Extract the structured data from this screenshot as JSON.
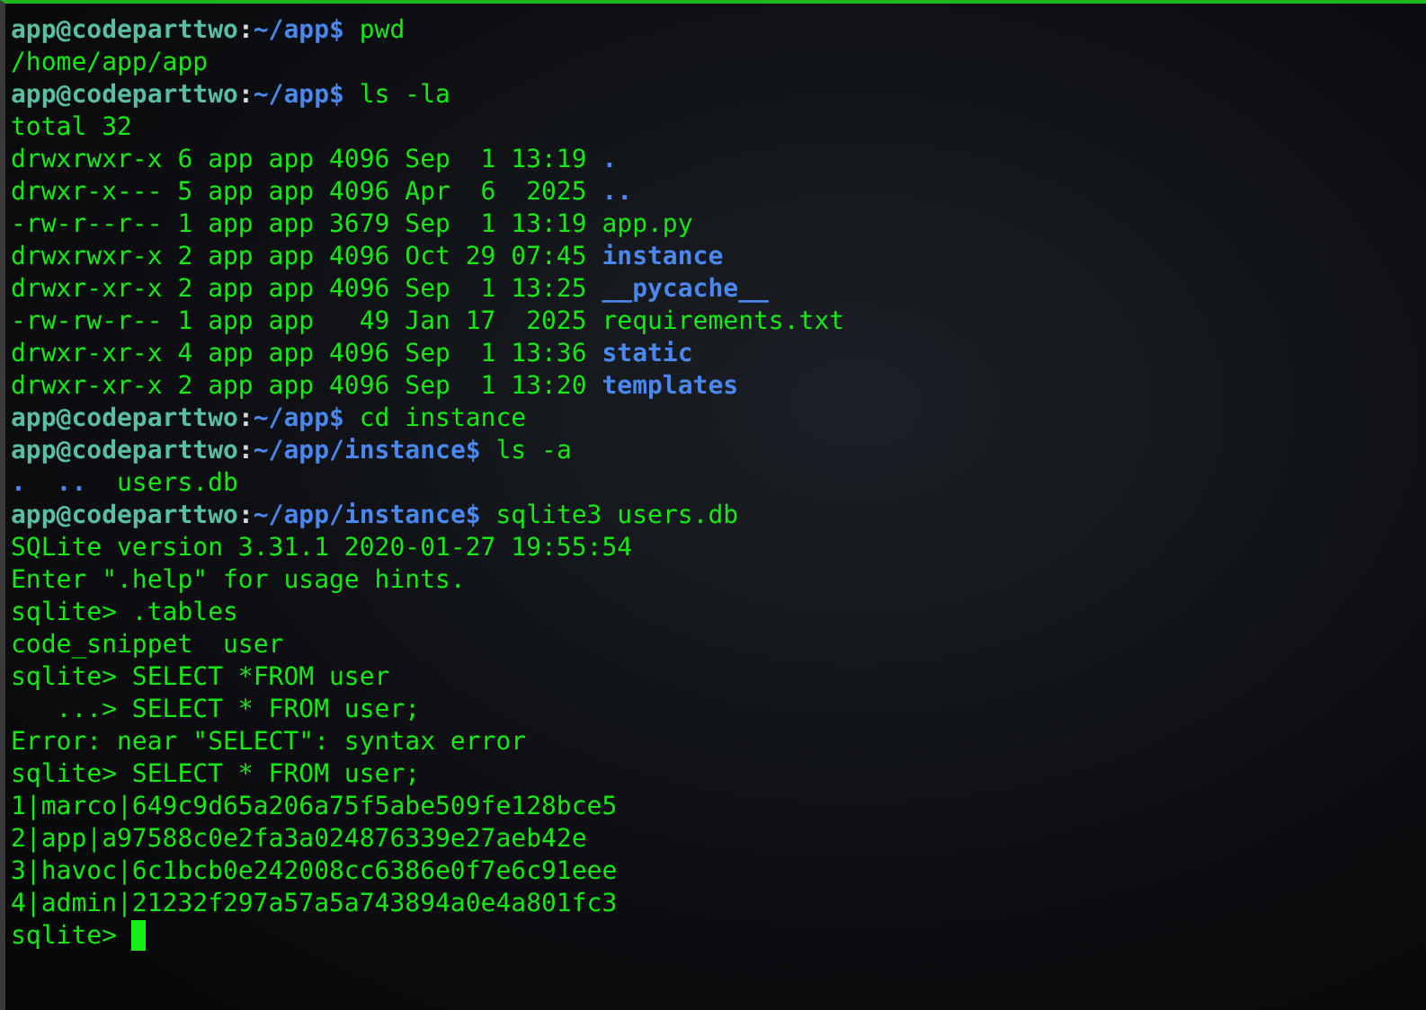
{
  "lines": [
    {
      "segments": [
        {
          "kind": "user",
          "text": "app@codeparttwo"
        },
        {
          "kind": "sep",
          "text": ":"
        },
        {
          "kind": "path",
          "text": "~/app$"
        },
        {
          "kind": "command",
          "text": "pwd"
        }
      ]
    },
    {
      "segments": [
        {
          "kind": "text",
          "text": "/home/app/app"
        }
      ]
    },
    {
      "segments": [
        {
          "kind": "user",
          "text": "app@codeparttwo"
        },
        {
          "kind": "sep",
          "text": ":"
        },
        {
          "kind": "path",
          "text": "~/app$"
        },
        {
          "kind": "command",
          "text": "ls -la"
        }
      ]
    },
    {
      "segments": [
        {
          "kind": "text",
          "text": "total 32"
        }
      ]
    },
    {
      "segments": [
        {
          "kind": "text",
          "text": "drwxrwxr-x 6 app app 4096 Sep  1 13:19"
        },
        {
          "kind": "dir",
          "text": "."
        }
      ]
    },
    {
      "segments": [
        {
          "kind": "text",
          "text": "drwxr-x--- 5 app app 4096 Apr  6  2025"
        },
        {
          "kind": "dir",
          "text": ".."
        }
      ]
    },
    {
      "segments": [
        {
          "kind": "text",
          "text": "-rw-r--r-- 1 app app 3679 Sep  1 13:19 app.py"
        }
      ]
    },
    {
      "segments": [
        {
          "kind": "text",
          "text": "drwxrwxr-x 2 app app 4096 Oct 29 07:45"
        },
        {
          "kind": "dir",
          "text": "instance"
        }
      ]
    },
    {
      "segments": [
        {
          "kind": "text",
          "text": "drwxr-xr-x 2 app app 4096 Sep  1 13:25"
        },
        {
          "kind": "dir",
          "text": "__pycache__"
        }
      ]
    },
    {
      "segments": [
        {
          "kind": "text",
          "text": "-rw-rw-r-- 1 app app   49 Jan 17  2025 requirements.txt"
        }
      ]
    },
    {
      "segments": [
        {
          "kind": "text",
          "text": "drwxr-xr-x 4 app app 4096 Sep  1 13:36"
        },
        {
          "kind": "dir",
          "text": "static"
        }
      ]
    },
    {
      "segments": [
        {
          "kind": "text",
          "text": "drwxr-xr-x 2 app app 4096 Sep  1 13:20"
        },
        {
          "kind": "dir",
          "text": "templates"
        }
      ]
    },
    {
      "segments": [
        {
          "kind": "user",
          "text": "app@codeparttwo"
        },
        {
          "kind": "sep",
          "text": ":"
        },
        {
          "kind": "path",
          "text": "~/app$"
        },
        {
          "kind": "command",
          "text": "cd instance"
        }
      ]
    },
    {
      "segments": [
        {
          "kind": "user",
          "text": "app@codeparttwo"
        },
        {
          "kind": "sep",
          "text": ":"
        },
        {
          "kind": "path",
          "text": "~/app/instance$"
        },
        {
          "kind": "command",
          "text": "ls -a"
        }
      ]
    },
    {
      "segments": [
        {
          "kind": "dir",
          "text": "."
        },
        {
          "kind": "dir",
          "text": ".."
        },
        {
          "kind": "file",
          "text": "users.db"
        }
      ]
    },
    {
      "segments": [
        {
          "kind": "user",
          "text": "app@codeparttwo"
        },
        {
          "kind": "sep",
          "text": ":"
        },
        {
          "kind": "path",
          "text": "~/app/instance$"
        },
        {
          "kind": "command",
          "text": "sqlite3 users.db"
        }
      ]
    },
    {
      "segments": [
        {
          "kind": "text",
          "text": "SQLite version 3.31.1 2020-01-27 19:55:54"
        }
      ]
    },
    {
      "segments": [
        {
          "kind": "text",
          "text": "Enter \".help\" for usage hints."
        }
      ]
    },
    {
      "segments": [
        {
          "kind": "text",
          "text": "sqlite> .tables"
        }
      ]
    },
    {
      "segments": [
        {
          "kind": "text",
          "text": "code_snippet  user"
        }
      ]
    },
    {
      "segments": [
        {
          "kind": "text",
          "text": "sqlite> SELECT *FROM user"
        }
      ]
    },
    {
      "segments": [
        {
          "kind": "text",
          "text": "   ...> SELECT * FROM user;"
        }
      ]
    },
    {
      "segments": [
        {
          "kind": "text",
          "text": "Error: near \"SELECT\": syntax error"
        }
      ]
    },
    {
      "segments": [
        {
          "kind": "text",
          "text": "sqlite> SELECT * FROM user;"
        }
      ]
    },
    {
      "segments": [
        {
          "kind": "text",
          "text": "1|marco|649c9d65a206a75f5abe509fe128bce5"
        }
      ]
    },
    {
      "segments": [
        {
          "kind": "text",
          "text": "2|app|a97588c0e2fa3a024876339e27aeb42e"
        }
      ]
    },
    {
      "segments": [
        {
          "kind": "text",
          "text": "3|havoc|6c1bcb0e242008cc6386e0f7e6c91eee"
        }
      ]
    },
    {
      "segments": [
        {
          "kind": "text",
          "text": "4|admin|21232f297a57a5a743894a0e4a801fc3"
        }
      ]
    },
    {
      "segments": [
        {
          "kind": "text",
          "text": "sqlite>"
        },
        {
          "kind": "cursor"
        }
      ]
    }
  ]
}
